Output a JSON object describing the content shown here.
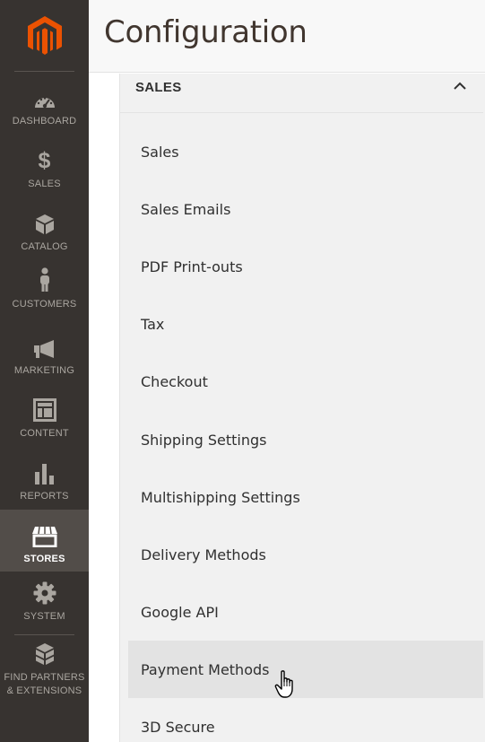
{
  "app": {
    "brand_color": "#eb5202",
    "logo_icon": "magento-logo-icon"
  },
  "sidebar": {
    "items": [
      {
        "label": "DASHBOARD",
        "icon": "dashboard-icon"
      },
      {
        "label": "SALES",
        "icon": "dollar-icon"
      },
      {
        "label": "CATALOG",
        "icon": "cube-icon"
      },
      {
        "label": "CUSTOMERS",
        "icon": "person-icon"
      },
      {
        "label": "MARKETING",
        "icon": "megaphone-icon"
      },
      {
        "label": "CONTENT",
        "icon": "layout-icon"
      },
      {
        "label": "REPORTS",
        "icon": "bar-chart-icon"
      },
      {
        "label": "STORES",
        "icon": "store-icon",
        "active": true
      },
      {
        "label": "SYSTEM",
        "icon": "gear-icon"
      },
      {
        "label": "FIND PARTNERS & EXTENSIONS",
        "icon": "blocks-icon"
      }
    ]
  },
  "header": {
    "title": "Configuration"
  },
  "config": {
    "section": {
      "title": "SALES",
      "expanded": true
    },
    "items": [
      {
        "label": "Sales"
      },
      {
        "label": "Sales Emails"
      },
      {
        "label": "PDF Print-outs"
      },
      {
        "label": "Tax"
      },
      {
        "label": "Checkout"
      },
      {
        "label": "Shipping Settings"
      },
      {
        "label": "Multishipping Settings"
      },
      {
        "label": "Delivery Methods"
      },
      {
        "label": "Google API"
      },
      {
        "label": "Payment Methods",
        "hovered": true
      },
      {
        "label": "3D Secure"
      }
    ]
  }
}
